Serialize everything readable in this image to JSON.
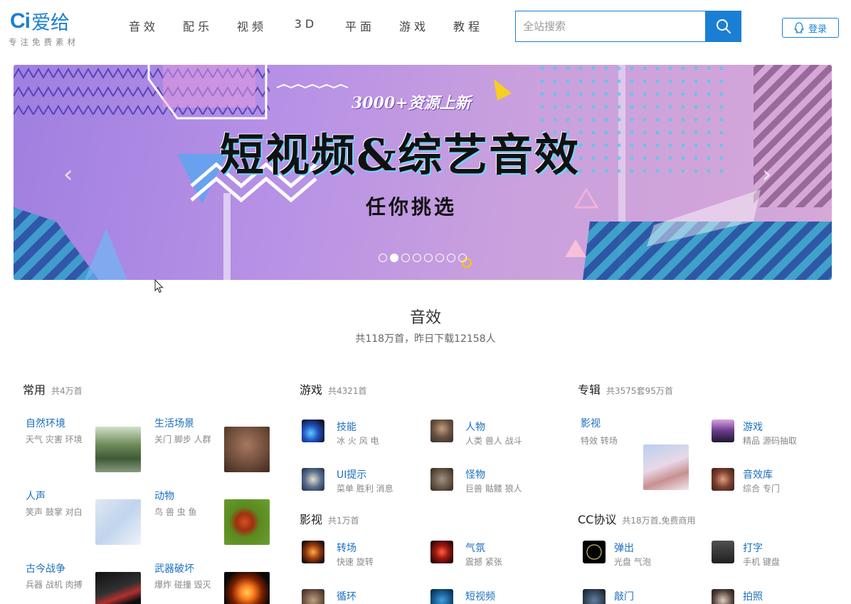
{
  "logo": {
    "ci": "Ci",
    "cn": "爱给",
    "slogan": "专注免费素材"
  },
  "nav": [
    "音效",
    "配乐",
    "视频",
    "3D",
    "平面",
    "游戏",
    "教程"
  ],
  "search": {
    "placeholder": "全站搜索"
  },
  "login": {
    "label": "登录"
  },
  "banner": {
    "subtitle": "3000+资源上新",
    "title": "短视频&综艺音效",
    "tagline": "任你挑选",
    "slides": 8,
    "active_slide": 2
  },
  "section": {
    "title": "音效",
    "stat": "共118万首，昨日下载12158人"
  },
  "columns": {
    "common": {
      "title": "常用",
      "count": "共4万首"
    },
    "game": {
      "title": "游戏",
      "count": "共4321首"
    },
    "album": {
      "title": "专辑",
      "count": "共3575套95万首"
    },
    "film": {
      "title": "影视",
      "count": "共1万首"
    },
    "cc": {
      "title": "CC协议",
      "count": "共18万首,免费商用"
    }
  },
  "common_items": [
    {
      "title": "自然环境",
      "sub": "天气 灾害 环境"
    },
    {
      "title": "生活场景",
      "sub": "关门 脚步 人群"
    },
    {
      "title": "人声",
      "sub": "笑声 鼓掌 对白"
    },
    {
      "title": "动物",
      "sub": "鸟 兽 虫 鱼"
    },
    {
      "title": "古今战争",
      "sub": "兵器 战机 肉搏"
    },
    {
      "title": "武器破坏",
      "sub": "爆炸 碰撞 毁灭"
    }
  ],
  "game_items": [
    {
      "title": "技能",
      "sub": "冰 火 风 电"
    },
    {
      "title": "人物",
      "sub": "人类 兽人 战斗"
    },
    {
      "title": "UI提示",
      "sub": "菜单 胜利 消息"
    },
    {
      "title": "怪物",
      "sub": "巨兽 骷髅 狼人"
    }
  ],
  "film_items": [
    {
      "title": "转场",
      "sub": "快速 旋转"
    },
    {
      "title": "气氛",
      "sub": "震撼 紧张"
    },
    {
      "title": "循环",
      "sub": ""
    },
    {
      "title": "短视频",
      "sub": ""
    }
  ],
  "album_items": [
    {
      "title": "影视",
      "sub": "特效 转场"
    },
    {
      "title": "游戏",
      "sub": "精品 源码抽取"
    },
    {
      "title": "音效库",
      "sub": "综合 专门"
    }
  ],
  "cc_items": [
    {
      "title": "弹出",
      "sub": "光盘 气泡"
    },
    {
      "title": "打字",
      "sub": "手机 键盘"
    },
    {
      "title": "敲门",
      "sub": ""
    },
    {
      "title": "拍照",
      "sub": ""
    }
  ],
  "colors": {
    "brand": "#1a7fd4",
    "link": "#1a6fbf"
  }
}
